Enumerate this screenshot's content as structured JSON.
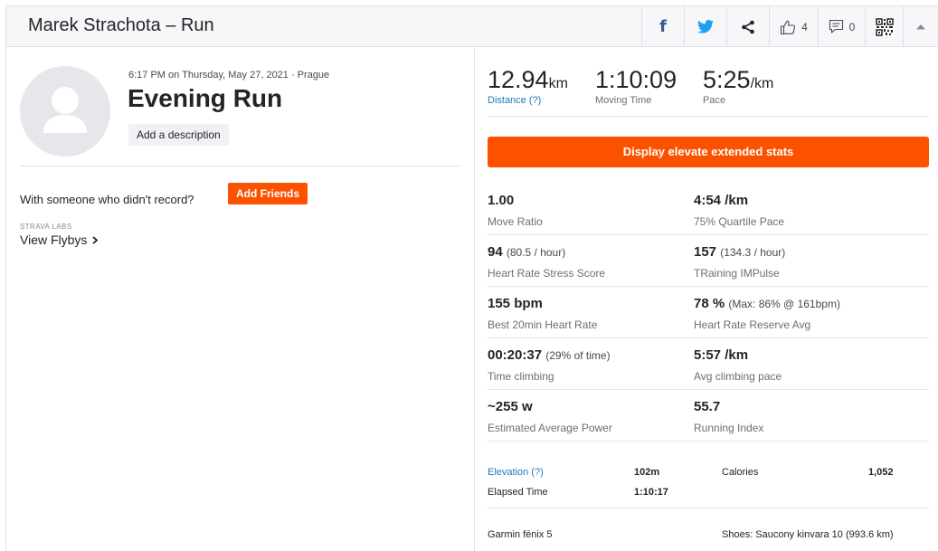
{
  "header": {
    "title": "Marek Strachota – Run",
    "kudos_count": "4",
    "comments_count": "0"
  },
  "activity": {
    "date_location": "6:17 PM on Thursday, May 27, 2021 · Prague",
    "name": "Evening Run",
    "add_description_label": "Add a description"
  },
  "social": {
    "with_someone_text": "With someone who didn't record?",
    "add_friends_label": "Add Friends",
    "labs_label": "STRAVA LABS",
    "flybys_label": "View Flybys"
  },
  "primary_stats": [
    {
      "value": "12.94",
      "unit": "km",
      "label": "Distance (?)"
    },
    {
      "value": "1:10:09",
      "unit": "",
      "label": "Moving Time"
    },
    {
      "value": "5:25",
      "unit": "/km",
      "label": "Pace"
    }
  ],
  "elevate_button_label": "Display elevate extended stats",
  "extended_stats": [
    {
      "left": {
        "value": "1.00",
        "sub": "",
        "label": "Move Ratio"
      },
      "right": {
        "value": "4:54 /km",
        "sub": "",
        "label": "75% Quartile Pace"
      }
    },
    {
      "left": {
        "value": "94",
        "sub": "(80.5 / hour)",
        "label": "Heart Rate Stress Score"
      },
      "right": {
        "value": "157",
        "sub": "(134.3 / hour)",
        "label": "TRaining IMPulse"
      }
    },
    {
      "left": {
        "value": "155 bpm",
        "sub": "",
        "label": "Best 20min Heart Rate"
      },
      "right": {
        "value": "78 %",
        "sub": "(Max: 86% @ 161bpm)",
        "label": "Heart Rate Reserve Avg"
      }
    },
    {
      "left": {
        "value": "00:20:37",
        "sub": "(29% of time)",
        "label": "Time climbing"
      },
      "right": {
        "value": "5:57 /km",
        "sub": "",
        "label": "Avg climbing pace"
      }
    },
    {
      "left": {
        "value": "~255 w",
        "sub": "",
        "label": "Estimated Average Power"
      },
      "right": {
        "value": "55.7",
        "sub": "",
        "label": "Running Index"
      }
    }
  ],
  "more_stats": {
    "elevation_label": "Elevation (?)",
    "elevation_value": "102m",
    "calories_label": "Calories",
    "calories_value": "1,052",
    "elapsed_label": "Elapsed Time",
    "elapsed_value": "1:10:17"
  },
  "device": "Garmin fēnix 5",
  "shoes": "Shoes: Saucony kinvara 10 (993.6 km)",
  "colors": {
    "accent": "#fc5200",
    "link": "#1e7bba",
    "facebook": "#3b5998",
    "twitter": "#1da1f2"
  },
  "icons": {
    "facebook": "facebook-icon",
    "twitter": "twitter-icon",
    "share": "share-icon",
    "kudos": "thumbs-up-icon",
    "comments": "comment-icon",
    "qr": "qr-code-icon",
    "collapse": "chevron-up-icon",
    "avatar": "user-avatar-icon",
    "flybys": "chevron-right-icon"
  }
}
